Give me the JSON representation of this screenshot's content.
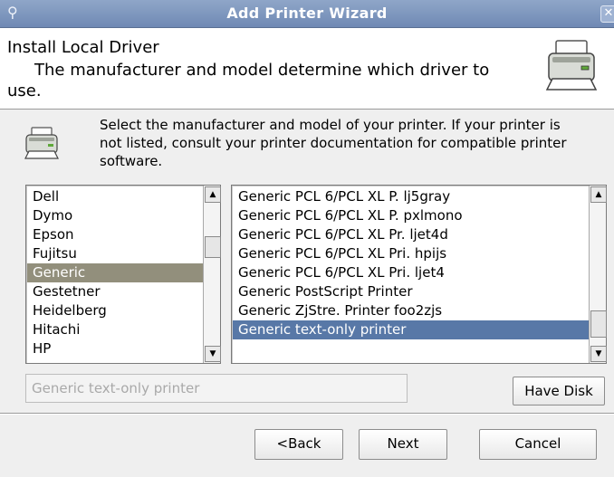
{
  "window": {
    "title": "Add Printer Wizard",
    "app_icon": "printer-dialog-icon",
    "close_glyph": "✕"
  },
  "header": {
    "title": "Install Local Driver",
    "subtitle": "The manufacturer and model determine which driver to use.",
    "icon": "printer-icon"
  },
  "instructions": "Select the manufacturer and model of your printer.  If your printer is not listed, consult your printer documentation for compatible printer software.",
  "manufacturers": {
    "items": [
      "Dell",
      "Dymo",
      "Epson",
      "Fujitsu",
      "Generic",
      "Gestetner",
      "Heidelberg",
      "Hitachi",
      "HP"
    ],
    "selected": "Generic"
  },
  "models": {
    "items": [
      "Generic PCL 6/PCL XL P. lj5gray",
      "Generic PCL 6/PCL XL P. pxlmono",
      "Generic PCL 6/PCL XL Pr. ljet4d",
      "Generic PCL 6/PCL XL Pri. hpijs",
      "Generic PCL 6/PCL XL Pri. ljet4",
      "Generic PostScript Printer",
      "Generic ZjStre. Printer foo2zjs",
      "Generic text-only printer"
    ],
    "selected": "Generic text-only printer"
  },
  "driver_field": {
    "value": "Generic text-only printer"
  },
  "buttons": {
    "have_disk": "Have Disk",
    "back": "<Back",
    "next": "Next",
    "cancel": "Cancel"
  },
  "colors": {
    "titlebar": "#7b93bc",
    "selection_blue": "#5878a7",
    "selection_gray": "#928f7c"
  }
}
